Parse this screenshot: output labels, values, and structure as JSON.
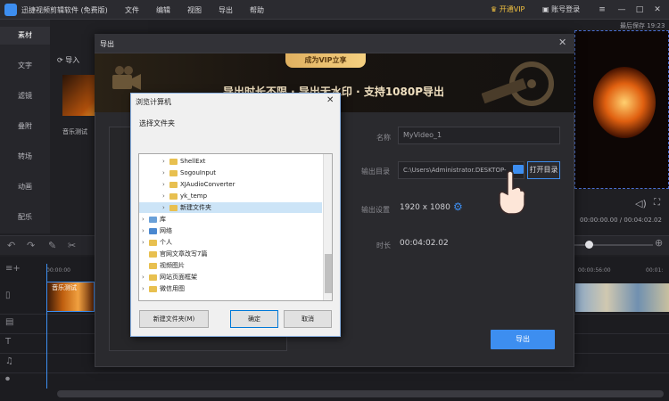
{
  "titlebar": {
    "app_title": "迅捷视频剪辑软件 (免费版)",
    "menus": [
      "文件",
      "编辑",
      "视图",
      "导出",
      "帮助"
    ],
    "vip_label": "开通VIP",
    "login_label": "账号登录"
  },
  "sidebar": {
    "items": [
      "素材",
      "文字",
      "滤镜",
      "叠附",
      "转场",
      "动画",
      "配乐"
    ]
  },
  "media": {
    "import_label": "导入",
    "thumb_label": "音乐测试"
  },
  "preview": {
    "autosave": "最后保存 19:23",
    "time_readout": "00:00:00.00 / 00:04:02.02"
  },
  "timeline": {
    "ruler_start": "00:00:00",
    "ruler_mid": "00:00:56:00",
    "ruler_end": "00:01:",
    "clip_label": "音乐测试"
  },
  "export_dialog": {
    "title": "导出",
    "banner_pill": "成为VIP立享",
    "banner_text": "导出时长不限 · 导出无水印 · 支持1080P导出",
    "name_label": "名称",
    "name_value": "MyVideo_1",
    "dir_label": "输出目录",
    "dir_value": "C:\\Users\\Administrator.DESKTOP-",
    "open_dir_label": "打开目录",
    "settings_label": "输出设置",
    "resolution": "1920 x 1080",
    "duration_label": "时长",
    "duration_value": "00:04:02.02",
    "export_label": "导出"
  },
  "browse_dialog": {
    "title": "浏览计算机",
    "prompt": "选择文件夹",
    "tree": [
      {
        "label": "ShellExt",
        "indent": 2,
        "arrow": "›"
      },
      {
        "label": "SogouInput",
        "indent": 2,
        "arrow": "›"
      },
      {
        "label": "XJAudioConverter",
        "indent": 2,
        "arrow": "›"
      },
      {
        "label": "yk_temp",
        "indent": 2,
        "arrow": "›"
      },
      {
        "label": "新建文件夹",
        "indent": 2,
        "arrow": "›"
      },
      {
        "label": "库",
        "indent": 0,
        "arrow": "›"
      },
      {
        "label": "网络",
        "indent": 0,
        "arrow": "›"
      },
      {
        "label": "个人",
        "indent": 0,
        "arrow": "›"
      },
      {
        "label": "官网文章改写7篇",
        "indent": 0,
        "arrow": ""
      },
      {
        "label": "视频图片",
        "indent": 0,
        "arrow": ""
      },
      {
        "label": "网站页面框架",
        "indent": 0,
        "arrow": "›"
      },
      {
        "label": "微信用图",
        "indent": 0,
        "arrow": "›"
      }
    ],
    "new_folder_label": "新建文件夹(M)",
    "ok_label": "确定",
    "cancel_label": "取消"
  },
  "colors": {
    "accent": "#3d8ef0",
    "vip_gold": "#f0c040"
  }
}
